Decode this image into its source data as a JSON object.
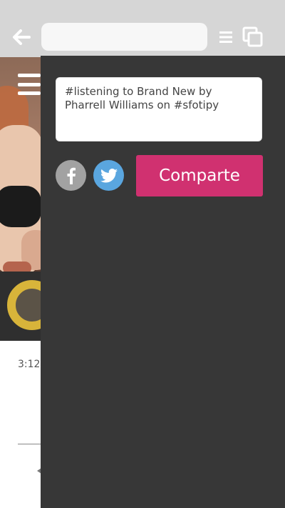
{
  "browser": {
    "back_icon": "back-arrow-icon",
    "url": "",
    "menu_icon": "menu-lines-icon",
    "tabs_icon": "tabs-icon"
  },
  "player": {
    "menu_icon": "hamburger-icon",
    "elapsed_time": "3:12"
  },
  "share_panel": {
    "message": "#listening to Brand New by Pharrell Williams on #sfotipy",
    "facebook_icon": "facebook-icon",
    "twitter_icon": "twitter-icon",
    "share_label": "Comparte",
    "colors": {
      "panel_bg": "#373737",
      "share_button": "#d03170",
      "facebook": "#a2a2a2",
      "twitter": "#5aa6df"
    }
  }
}
